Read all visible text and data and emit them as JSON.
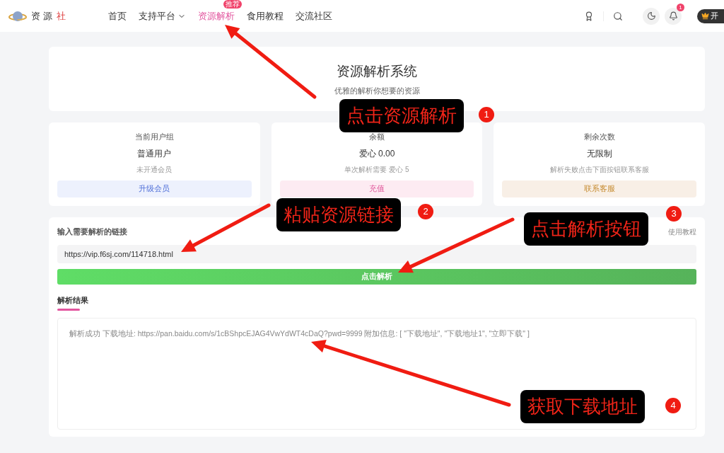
{
  "header": {
    "logo": {
      "text": "资 源",
      "accent": "社"
    },
    "nav": [
      {
        "label": "首页",
        "selected": false
      },
      {
        "label": "支持平台",
        "selected": false,
        "dropdown": true
      },
      {
        "label": "资源解析",
        "selected": true,
        "badge": "推荐"
      },
      {
        "label": "食用教程",
        "selected": false
      },
      {
        "label": "交流社区",
        "selected": false
      }
    ],
    "notification_count": "1",
    "vip_button": "开"
  },
  "hero": {
    "title": "资源解析系统",
    "subtitle": "优雅的解析你想要的资源"
  },
  "stats": [
    {
      "kind": "blue",
      "title": "当前用户组",
      "value": "普通用户",
      "note": "未开通会员",
      "button": "升级会员"
    },
    {
      "kind": "pink",
      "title": "余额",
      "value": "爱心 0.00",
      "note": "单次解析需要 爱心 5",
      "button": "充值"
    },
    {
      "kind": "orange",
      "title": "剩余次数",
      "value": "无限制",
      "note": "解析失败点击下面按钮联系客服",
      "button": "联系客服"
    }
  ],
  "parser": {
    "label": "输入需要解析的链接",
    "tutorial_link": "使用教程",
    "url": "https://vip.f6sj.com/114718.html",
    "button": "点击解析",
    "result_heading": "解析结果",
    "result": "解析成功 下载地址: https://pan.baidu.com/s/1cBShpcEJAG4VwYdWT4cDaQ?pwd=9999 附加信息: [ \"下载地址\", \"下载地址1\", \"立即下载\" ]"
  },
  "annotations": [
    {
      "number": "1",
      "label": "点击资源解析"
    },
    {
      "number": "2",
      "label": "粘贴资源链接"
    },
    {
      "number": "3",
      "label": "点击解析按钮"
    },
    {
      "number": "4",
      "label": "获取下载地址"
    }
  ]
}
